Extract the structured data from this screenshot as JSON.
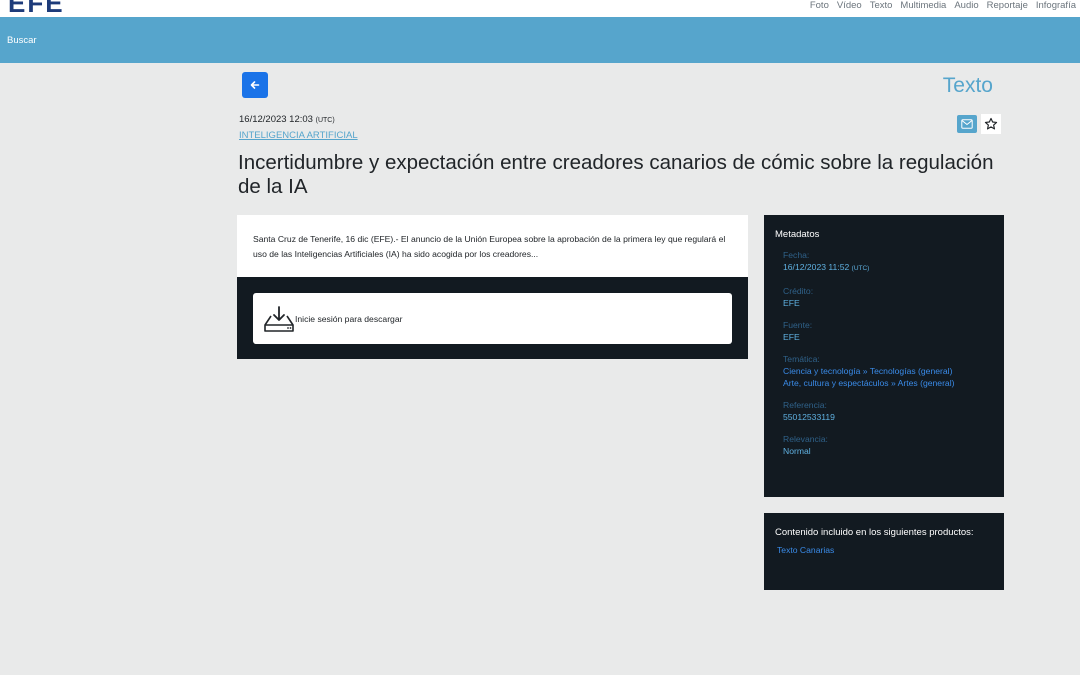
{
  "brand": {
    "logo": "EFE"
  },
  "topnav": [
    "Foto",
    "Vídeo",
    "Texto",
    "Multimedia",
    "Audio",
    "Reportaje",
    "Infografía"
  ],
  "search": {
    "label": "Buscar"
  },
  "article": {
    "type": "Texto",
    "date": "16/12/2023 12:03",
    "tz": "(UTC)",
    "category": "INTELIGENCIA ARTIFICIAL",
    "headline": "Incertidumbre y expectación entre creadores canarios de cómic sobre la regulación de la IA",
    "summary": "Santa Cruz de Tenerife, 16 dic (EFE).- El anuncio de la Unión Europea sobre la aprobación de la primera ley que regulará el uso de las Inteligencias Artificiales (IA) ha sido acogida por los creadores...",
    "download_label": "Inicie sesión para descargar"
  },
  "metadata": {
    "title": "Metadatos",
    "fecha_label": "Fecha:",
    "fecha_value": "16/12/2023 11:52",
    "fecha_tz": "(UTC)",
    "credito_label": "Crédito:",
    "credito_value": "EFE",
    "fuente_label": "Fuente:",
    "fuente_value": "EFE",
    "tematica_label": "Temática:",
    "tematica_1": "Ciencia y tecnología » Tecnologías (general)",
    "tematica_2": "Arte, cultura y espectáculos » Artes (general)",
    "referencia_label": "Referencia:",
    "referencia_value": "55012533119",
    "relevancia_label": "Relevancia:",
    "relevancia_value": "Normal"
  },
  "products": {
    "title": "Contenido incluido en los siguientes productos:",
    "items": [
      "Texto Canarias"
    ]
  },
  "colors": {
    "accent": "#56a5cc",
    "dark_panel": "#121a21",
    "link": "#3a8be8",
    "primary_button": "#1a73e8"
  }
}
